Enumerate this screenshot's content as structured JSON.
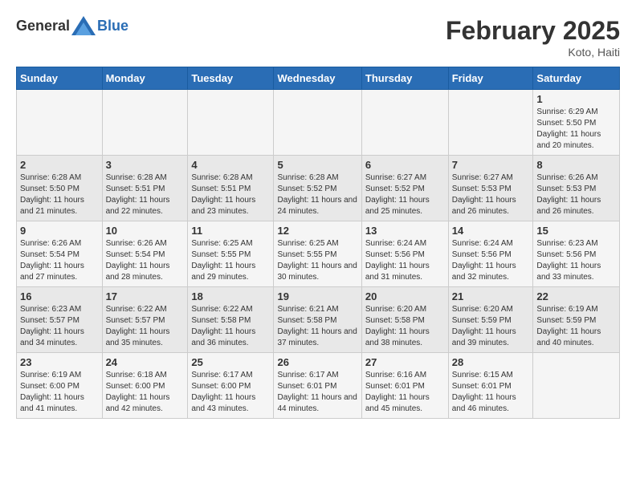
{
  "header": {
    "logo_general": "General",
    "logo_blue": "Blue",
    "title": "February 2025",
    "location": "Koto, Haiti"
  },
  "days_of_week": [
    "Sunday",
    "Monday",
    "Tuesday",
    "Wednesday",
    "Thursday",
    "Friday",
    "Saturday"
  ],
  "weeks": [
    [
      {
        "day": "",
        "info": ""
      },
      {
        "day": "",
        "info": ""
      },
      {
        "day": "",
        "info": ""
      },
      {
        "day": "",
        "info": ""
      },
      {
        "day": "",
        "info": ""
      },
      {
        "day": "",
        "info": ""
      },
      {
        "day": "1",
        "info": "Sunrise: 6:29 AM\nSunset: 5:50 PM\nDaylight: 11 hours and 20 minutes."
      }
    ],
    [
      {
        "day": "2",
        "info": "Sunrise: 6:28 AM\nSunset: 5:50 PM\nDaylight: 11 hours and 21 minutes."
      },
      {
        "day": "3",
        "info": "Sunrise: 6:28 AM\nSunset: 5:51 PM\nDaylight: 11 hours and 22 minutes."
      },
      {
        "day": "4",
        "info": "Sunrise: 6:28 AM\nSunset: 5:51 PM\nDaylight: 11 hours and 23 minutes."
      },
      {
        "day": "5",
        "info": "Sunrise: 6:28 AM\nSunset: 5:52 PM\nDaylight: 11 hours and 24 minutes."
      },
      {
        "day": "6",
        "info": "Sunrise: 6:27 AM\nSunset: 5:52 PM\nDaylight: 11 hours and 25 minutes."
      },
      {
        "day": "7",
        "info": "Sunrise: 6:27 AM\nSunset: 5:53 PM\nDaylight: 11 hours and 26 minutes."
      },
      {
        "day": "8",
        "info": "Sunrise: 6:26 AM\nSunset: 5:53 PM\nDaylight: 11 hours and 26 minutes."
      }
    ],
    [
      {
        "day": "9",
        "info": "Sunrise: 6:26 AM\nSunset: 5:54 PM\nDaylight: 11 hours and 27 minutes."
      },
      {
        "day": "10",
        "info": "Sunrise: 6:26 AM\nSunset: 5:54 PM\nDaylight: 11 hours and 28 minutes."
      },
      {
        "day": "11",
        "info": "Sunrise: 6:25 AM\nSunset: 5:55 PM\nDaylight: 11 hours and 29 minutes."
      },
      {
        "day": "12",
        "info": "Sunrise: 6:25 AM\nSunset: 5:55 PM\nDaylight: 11 hours and 30 minutes."
      },
      {
        "day": "13",
        "info": "Sunrise: 6:24 AM\nSunset: 5:56 PM\nDaylight: 11 hours and 31 minutes."
      },
      {
        "day": "14",
        "info": "Sunrise: 6:24 AM\nSunset: 5:56 PM\nDaylight: 11 hours and 32 minutes."
      },
      {
        "day": "15",
        "info": "Sunrise: 6:23 AM\nSunset: 5:56 PM\nDaylight: 11 hours and 33 minutes."
      }
    ],
    [
      {
        "day": "16",
        "info": "Sunrise: 6:23 AM\nSunset: 5:57 PM\nDaylight: 11 hours and 34 minutes."
      },
      {
        "day": "17",
        "info": "Sunrise: 6:22 AM\nSunset: 5:57 PM\nDaylight: 11 hours and 35 minutes."
      },
      {
        "day": "18",
        "info": "Sunrise: 6:22 AM\nSunset: 5:58 PM\nDaylight: 11 hours and 36 minutes."
      },
      {
        "day": "19",
        "info": "Sunrise: 6:21 AM\nSunset: 5:58 PM\nDaylight: 11 hours and 37 minutes."
      },
      {
        "day": "20",
        "info": "Sunrise: 6:20 AM\nSunset: 5:58 PM\nDaylight: 11 hours and 38 minutes."
      },
      {
        "day": "21",
        "info": "Sunrise: 6:20 AM\nSunset: 5:59 PM\nDaylight: 11 hours and 39 minutes."
      },
      {
        "day": "22",
        "info": "Sunrise: 6:19 AM\nSunset: 5:59 PM\nDaylight: 11 hours and 40 minutes."
      }
    ],
    [
      {
        "day": "23",
        "info": "Sunrise: 6:19 AM\nSunset: 6:00 PM\nDaylight: 11 hours and 41 minutes."
      },
      {
        "day": "24",
        "info": "Sunrise: 6:18 AM\nSunset: 6:00 PM\nDaylight: 11 hours and 42 minutes."
      },
      {
        "day": "25",
        "info": "Sunrise: 6:17 AM\nSunset: 6:00 PM\nDaylight: 11 hours and 43 minutes."
      },
      {
        "day": "26",
        "info": "Sunrise: 6:17 AM\nSunset: 6:01 PM\nDaylight: 11 hours and 44 minutes."
      },
      {
        "day": "27",
        "info": "Sunrise: 6:16 AM\nSunset: 6:01 PM\nDaylight: 11 hours and 45 minutes."
      },
      {
        "day": "28",
        "info": "Sunrise: 6:15 AM\nSunset: 6:01 PM\nDaylight: 11 hours and 46 minutes."
      },
      {
        "day": "",
        "info": ""
      }
    ]
  ]
}
